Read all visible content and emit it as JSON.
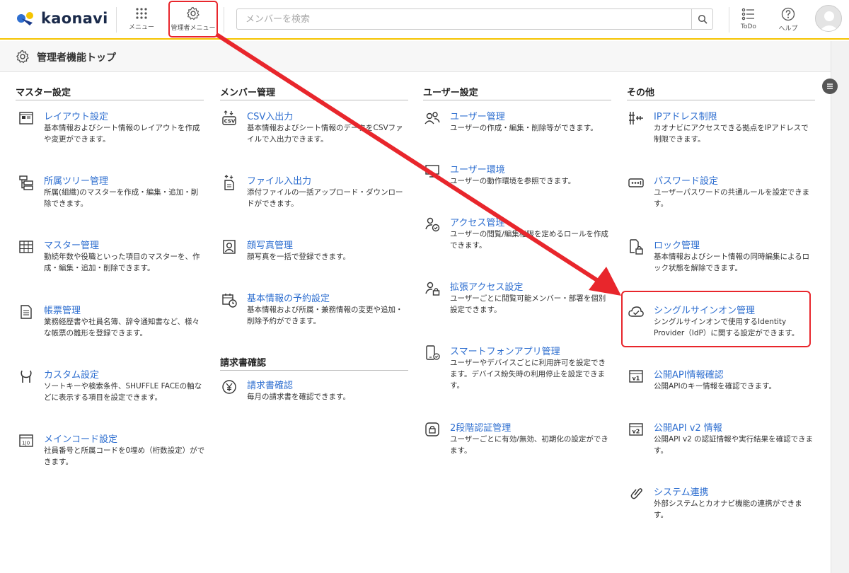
{
  "header": {
    "logo_text": "kaonavi",
    "menu_label": "メニュー",
    "admin_menu_label": "管理者メニュー",
    "search_placeholder": "メンバーを検索",
    "todo_label": "ToDo",
    "help_label": "ヘルプ",
    "accent_color": "#f5c400",
    "highlight_color": "#e8262c"
  },
  "breadcrumb": {
    "title": "管理者機能トップ"
  },
  "columns": [
    {
      "heading": "マスター設定",
      "items": [
        {
          "label": "レイアウト設定",
          "desc": "基本情報およびシート情報のレイアウトを作成や変更ができます。",
          "icon": "layout-icon"
        },
        {
          "label": "所属ツリー管理",
          "desc": "所属(組織)のマスターを作成・編集・追加・削除できます。",
          "icon": "tree-icon"
        },
        {
          "label": "マスター管理",
          "desc": "勤続年数や役職といった項目のマスターを、作成・編集・追加・削除できます。",
          "icon": "table-icon"
        },
        {
          "label": "帳票管理",
          "desc": "業務経歴書や社員名簿、辞令通知書など、様々な帳票の雛形を登録できます。",
          "icon": "document-icon"
        },
        {
          "label": "カスタム設定",
          "desc": "ソートキーや検索条件、SHUFFLE FACEの軸などに表示する項目を設定できます。",
          "icon": "wrench-icon"
        },
        {
          "label": "メインコード設定",
          "desc": "社員番号と所属コードを0埋め（桁数設定）ができます。",
          "icon": "code-icon"
        }
      ]
    },
    {
      "heading": "メンバー管理",
      "items": [
        {
          "label": "CSV入出力",
          "desc": "基本情報およびシート情報のデータをCSVファイルで入出力できます。",
          "icon": "csv-icon"
        },
        {
          "label": "ファイル入出力",
          "desc": "添付ファイルの一括アップロード・ダウンロードができます。",
          "icon": "file-transfer-icon"
        },
        {
          "label": "顔写真管理",
          "desc": "顔写真を一括で登録できます。",
          "icon": "portrait-icon"
        },
        {
          "label": "基本情報の予約設定",
          "desc": "基本情報および所属・兼務情報の変更や追加・削除予約ができます。",
          "icon": "calendar-clock-icon"
        }
      ],
      "heading2": "請求書確認",
      "items2": [
        {
          "label": "請求書確認",
          "desc": "毎月の請求書を確認できます。",
          "icon": "yen-icon"
        }
      ]
    },
    {
      "heading": "ユーザー設定",
      "items": [
        {
          "label": "ユーザー管理",
          "desc": "ユーザーの作成・編集・削除等ができます。",
          "icon": "users-icon"
        },
        {
          "label": "ユーザー環境",
          "desc": "ユーザーの動作環境を参照できます。",
          "icon": "monitor-icon"
        },
        {
          "label": "アクセス管理",
          "desc": "ユーザーの閲覧/編集権限を定めるロールを作成できます。",
          "icon": "user-check-icon"
        },
        {
          "label": "拡張アクセス設定",
          "desc": "ユーザーごとに閲覧可能メンバー・部署を個別設定できます。",
          "icon": "user-lock-icon"
        },
        {
          "label": "スマートフォンアプリ管理",
          "desc": "ユーザーやデバイスごとに利用許可を設定できます。デバイス紛失時の利用停止を設定できます。",
          "icon": "smartphone-icon"
        },
        {
          "label": "2段階認証管理",
          "desc": "ユーザーごとに有効/無効、初期化の設定ができます。",
          "icon": "two-factor-icon"
        }
      ]
    },
    {
      "heading": "その他",
      "items": [
        {
          "label": "IPアドレス制限",
          "desc": "カオナビにアクセスできる拠点をIPアドレスで制限できます。",
          "icon": "ip-restrict-icon"
        },
        {
          "label": "パスワード設定",
          "desc": "ユーザーパスワードの共通ルールを設定できます。",
          "icon": "password-icon"
        },
        {
          "label": "ロック管理",
          "desc": "基本情報およびシート情報の同時編集によるロック状態を解除できます。",
          "icon": "lock-file-icon"
        },
        {
          "label": "シングルサインオン管理",
          "desc": "シングルサインオンで使用するIdentity Provider（IdP）に関する設定ができます。",
          "icon": "cloud-check-icon"
        },
        {
          "label": "公開API情報確認",
          "desc": "公開APIのキー情報を確認できます。",
          "icon": "api-v1-icon"
        },
        {
          "label": "公開API v2 情報",
          "desc": "公開API v2 の認証情報や実行結果を確認できます。",
          "icon": "api-v2-icon"
        },
        {
          "label": "システム連携",
          "desc": "外部システムとカオナビ機能の連携ができます。",
          "icon": "link-icon"
        }
      ]
    }
  ]
}
